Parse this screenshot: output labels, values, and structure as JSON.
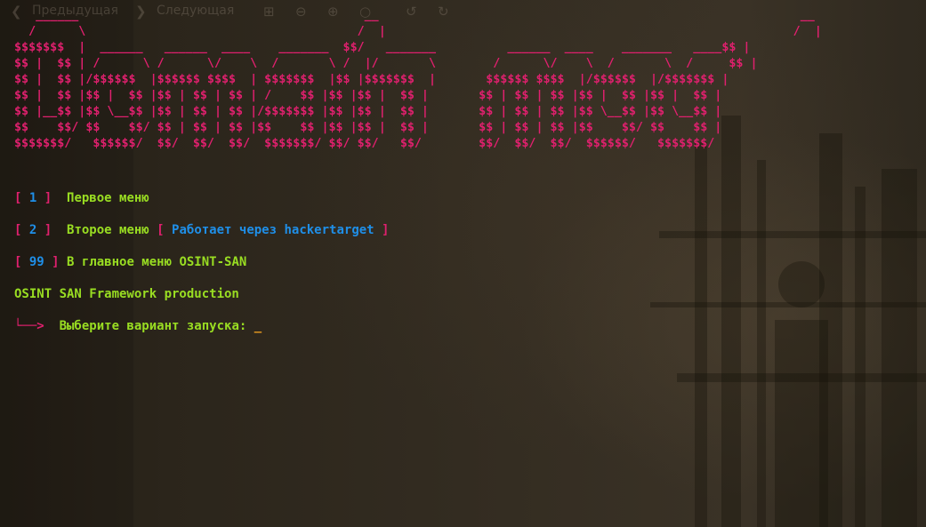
{
  "toolbar": {
    "prev_label": "Предыдущая",
    "next_label": "Следующая"
  },
  "banner_lines": [
    "   ______                                        __                                                           __",
    "  /      \\                                      /  |                                                         /  |",
    "$$$$$$$  |  ______   ______  ____    _______  $$/   _______          ______  ____    _______   ____$$ |",
    "$$ |  $$ | /      \\ /      \\/    \\  /       \\ /  |/       \\        /      \\/    \\  /       \\  /     $$ |",
    "$$ |  $$ |/$$$$$$  |$$$$$$ $$$$  | $$$$$$$  |$$ |$$$$$$$  |       $$$$$$ $$$$  |/$$$$$$  |/$$$$$$$ |",
    "$$ |  $$ |$$ |  $$ |$$ | $$ | $$ | /    $$ |$$ |$$ |  $$ |       $$ | $$ | $$ |$$ |  $$ |$$ |  $$ |",
    "$$ |__$$ |$$ \\__$$ |$$ | $$ | $$ |/$$$$$$$ |$$ |$$ |  $$ |       $$ | $$ | $$ |$$ \\__$$ |$$ \\__$$ |",
    "$$    $$/ $$    $$/ $$ | $$ | $$ |$$    $$ |$$ |$$ |  $$ |       $$ | $$ | $$ |$$    $$/ $$    $$ |",
    "$$$$$$$/   $$$$$$/  $$/  $$/  $$/  $$$$$$$/ $$/ $$/   $$/        $$/  $$/  $$/  $$$$$$/   $$$$$$$/"
  ],
  "menu": {
    "item1": {
      "open": "[ ",
      "num": "1",
      "close": " ]",
      "label": "Первое меню"
    },
    "item2": {
      "open": "[ ",
      "num": "2",
      "close": " ]",
      "label": "Второе меню",
      "note_open": "[ ",
      "note": "Работает через hackertarget",
      "note_close": " ]"
    },
    "item3": {
      "open": "[ ",
      "num": "99",
      "close": " ]",
      "label": "В главное меню OSINT-SAN"
    },
    "footer": "OSINT SAN Framework production",
    "prompt_arrow": "└──>",
    "prompt_text": "Выберите вариант запуска:",
    "cursor": "_"
  },
  "colors": {
    "accent_pink": "#e0206e",
    "accent_green": "#99dd22",
    "accent_blue": "#1f8fe8",
    "cursor": "#f0a020"
  }
}
